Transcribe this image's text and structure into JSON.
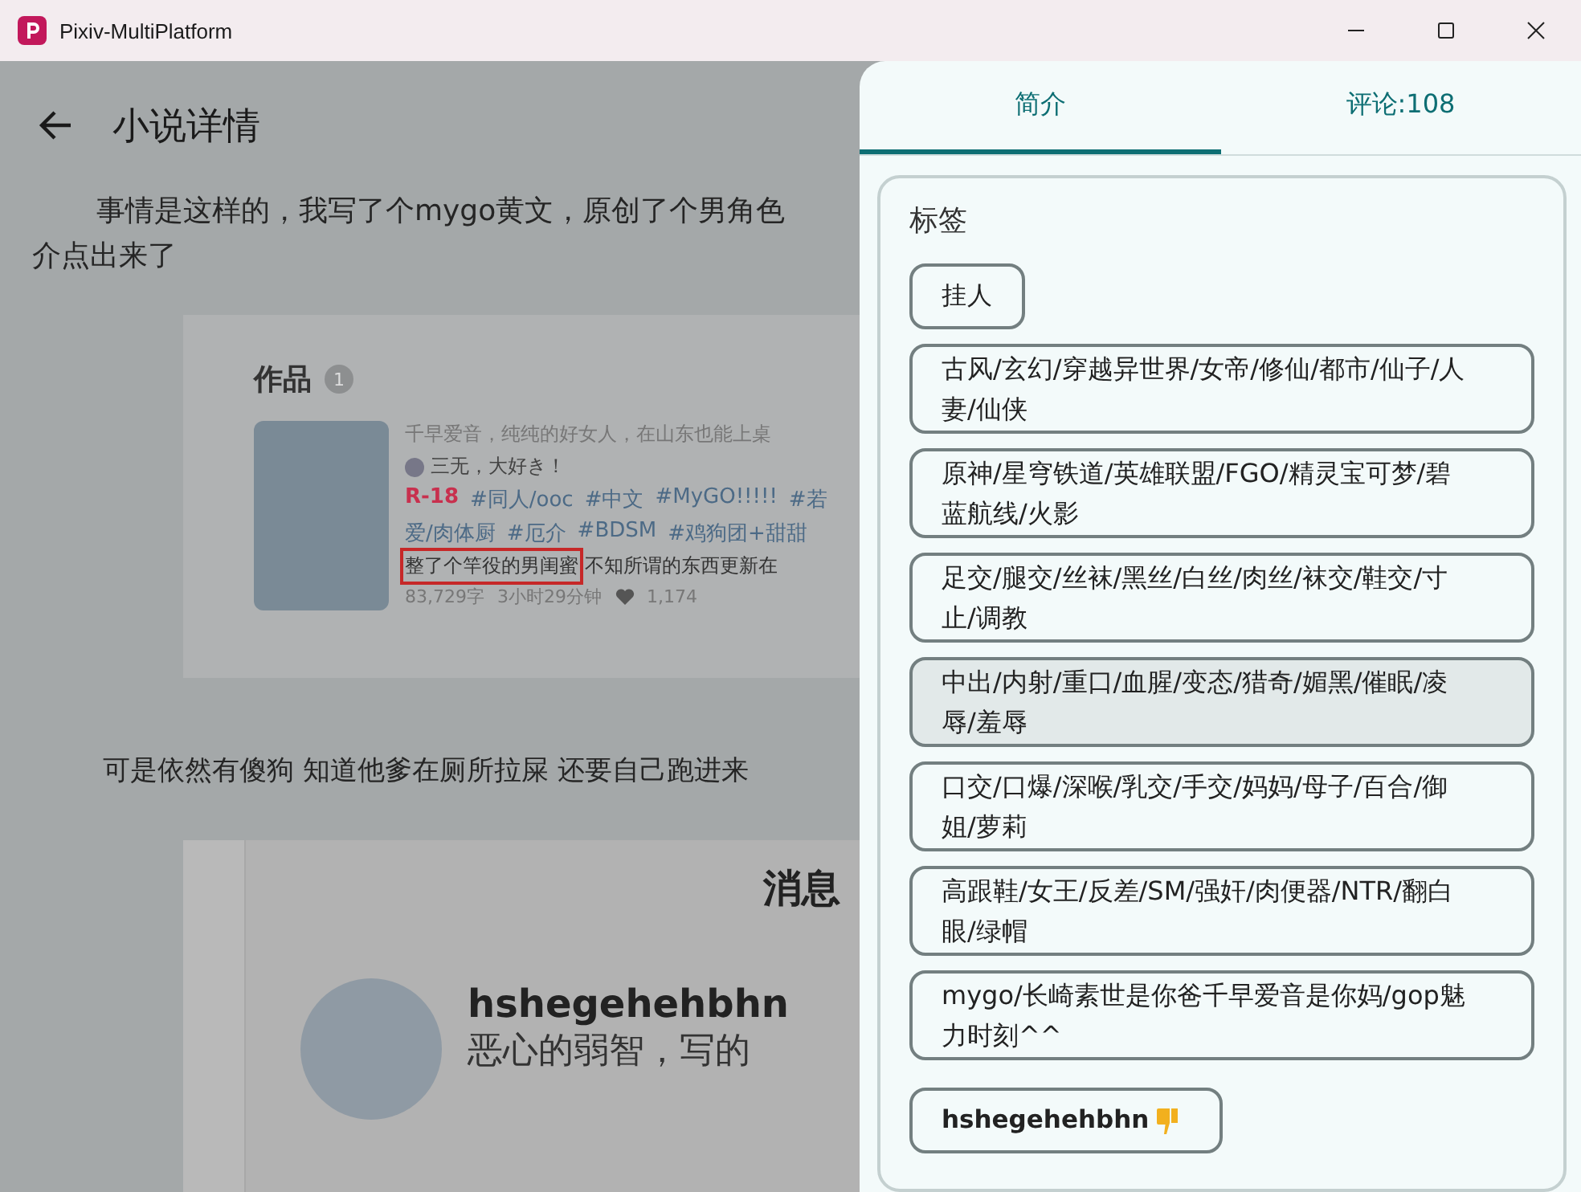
{
  "window": {
    "title": "Pixiv-MultiPlatform"
  },
  "page": {
    "title": "小说详情",
    "paragraph_1": [
      "事情是这样的，我写了个mygo黄文，原创了个男角色",
      "介点出来了"
    ],
    "works_screenshot": {
      "heading": "作品",
      "count": "1",
      "summary": "千早爱音，纯纯的好女人，在山东也能上桌",
      "author": "三无，大好き！",
      "rating": "R-18",
      "tag_lines": [
        [
          "#同人/ooc",
          "#中文",
          "#MyGO!!!!!",
          "#若"
        ],
        [
          "爱/肉体厨",
          "#厄介",
          "#BDSM",
          "#鸡狗团+甜甜"
        ]
      ],
      "highlighted_text": "整了个竿役的男闺蜜",
      "description_rest": "不知所谓的东西更新在",
      "stats": [
        "83,729字",
        "3小时29分钟"
      ],
      "likes": "1,174"
    },
    "paragraph_2": "可是依然有傻狗 知道他爹在厕所拉屎 还要自己跑进来",
    "message_screenshot": {
      "title": "消息",
      "username": "hshegehehbhn",
      "message": "恶心的弱智，写的"
    }
  },
  "drawer": {
    "tabs": [
      {
        "label": "简介",
        "selected": true
      },
      {
        "label": "评论:108",
        "selected": false
      }
    ],
    "tags_card": {
      "heading": "标签",
      "tags": [
        {
          "text": "挂人",
          "selected": false
        },
        {
          "text": "古风/玄幻/穿越异世界/女帝/修仙/都市/仙子/人妻/仙侠",
          "selected": false
        },
        {
          "text": "原神/星穹铁道/英雄联盟/FGO/精灵宝可梦/碧蓝航线/火影",
          "selected": false
        },
        {
          "text": "足交/腿交/丝袜/黑丝/白丝/肉丝/袜交/鞋交/寸止/调教",
          "selected": false
        },
        {
          "text": "中出/内射/重口/血腥/变态/猎奇/媚黑/催眠/凌辱/羞辱",
          "selected": true
        },
        {
          "text": "口交/口爆/深喉/乳交/手交/妈妈/母子/百合/御姐/萝莉",
          "selected": false
        },
        {
          "text": "高跟鞋/女王/反差/SM/强奸/肉便器/NTR/翻白眼/绿帽",
          "selected": false
        },
        {
          "text": "mygo/长崎素世是你爸千早爱音是你妈/gop魅力时刻^^",
          "selected": false
        },
        {
          "text": "hshegehehbhn",
          "selected": false,
          "kind": "disliked-user"
        }
      ]
    }
  }
}
